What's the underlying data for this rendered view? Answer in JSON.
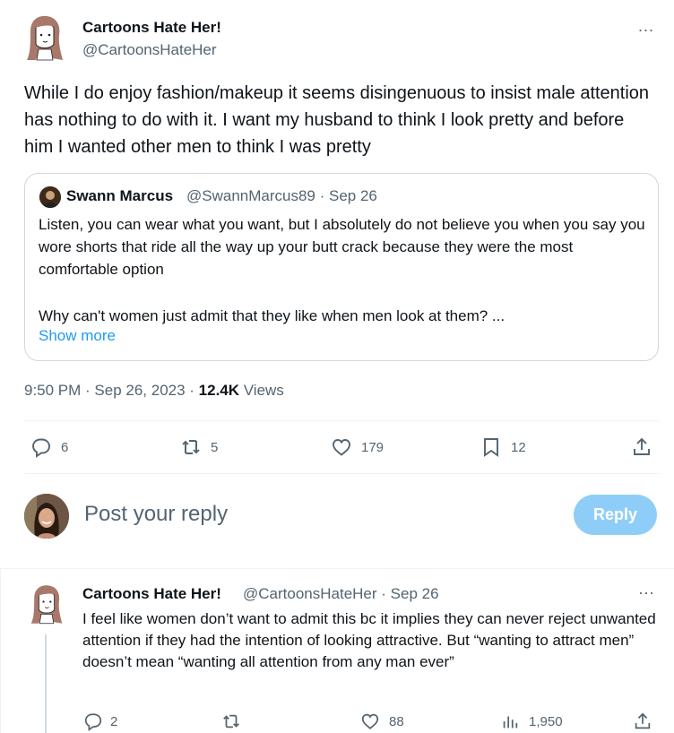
{
  "tweet": {
    "author_name": "Cartoons Hate Her!",
    "author_handle": "@CartoonsHateHer",
    "more_icon": "...",
    "text": "While I do enjoy fashion/makeup it seems disingenuous to insist male attention has nothing to do with it. I want my husband to think I look pretty and before him I wanted other men to think I was pretty",
    "time": "9:50 PM · Sep 26, 2023 · ",
    "views_count": "12.4K",
    "views_label": " Views"
  },
  "quote": {
    "author_name": "Swann Marcus",
    "meta": "@SwannMarcus89 · Sep 26",
    "paragraph1": "Listen, you can wear what you want, but I absolutely do not believe you when you say you wore shorts that ride all the way up your butt crack because they were the most comfortable option",
    "paragraph2": "Why can't women just admit that they like when men look at them? ...",
    "show_more": "Show more"
  },
  "actions": {
    "replies": "6",
    "reposts": "5",
    "likes": "179",
    "bookmarks": "12"
  },
  "composer": {
    "placeholder": "Post your reply",
    "button": "Reply"
  },
  "reply": {
    "author_name": "Cartoons Hate Her!",
    "meta": "@CartoonsHateHer · Sep 26",
    "more_icon": "···",
    "text": "I feel like women don’t want to admit this bc it implies they can never reject unwanted attention if they had the intention of looking attractive. But “wanting to attract men” doesn’t mean “wanting all attention from any man ever”",
    "actions": {
      "replies": "2",
      "likes": "88",
      "views": "1,950"
    }
  },
  "icons": {
    "reply": "reply-icon",
    "repost": "repost-icon",
    "like": "heart-icon",
    "bookmark": "bookmark-icon",
    "share": "share-icon",
    "views": "analytics-icon"
  },
  "colors": {
    "accent": "#1d9bf0",
    "reply_button_disabled": "#8ecdf8",
    "secondary_text": "#536471",
    "border": "#cfd9de"
  }
}
